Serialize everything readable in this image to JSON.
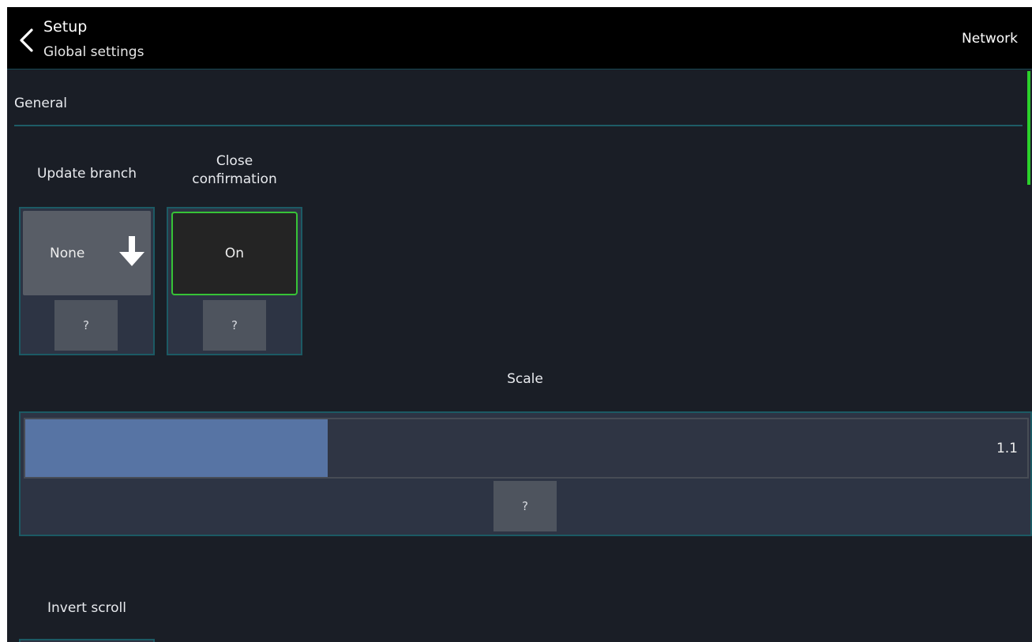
{
  "header": {
    "title": "Setup",
    "subtitle": "Global settings",
    "right_action": "Network"
  },
  "sections": [
    {
      "label": "General",
      "settings": {
        "update_branch": {
          "label": "Update branch",
          "value": "None",
          "icon": "arrow-down-icon",
          "help": "?"
        },
        "close_confirmation": {
          "label": "Close confirmation",
          "label_lines": [
            "Close",
            "confirmation"
          ],
          "value": "On",
          "help": "?"
        },
        "scale": {
          "label": "Scale",
          "value": "1.1",
          "fill_fraction": 0.302,
          "help": "?"
        },
        "invert_scroll": {
          "label": "Invert scroll"
        }
      }
    }
  ],
  "colors": {
    "background": "#1a1e26",
    "header": "#000000",
    "card": "#2d3444",
    "card_border": "#1c5a64",
    "button": "#585d66",
    "toggle_on_border": "#37c337",
    "slider_fill": "#5774a4",
    "scroll_indicator": "#2bd12b"
  }
}
